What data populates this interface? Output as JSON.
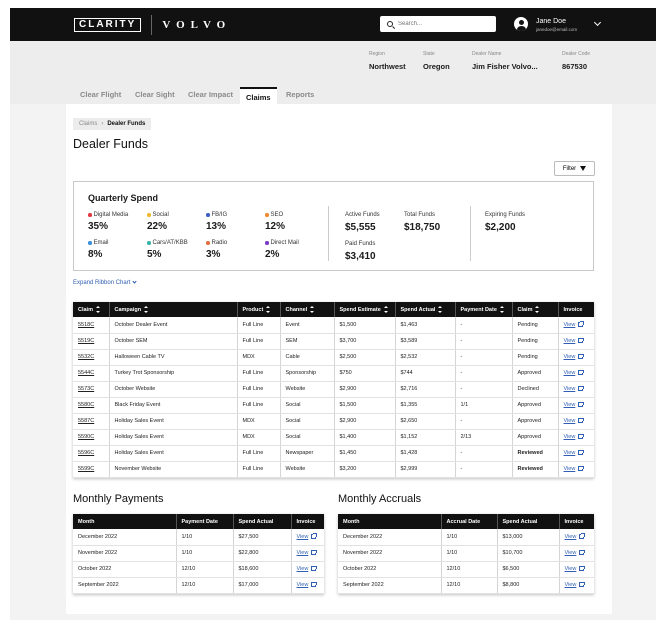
{
  "header": {
    "brand": "CLARITY",
    "partner": "VOLVO",
    "search_placeholder": "Search...",
    "user_name": "Jane Doe",
    "user_email": "janedoe@email.com"
  },
  "dealer": {
    "region_label": "Region",
    "region": "Northwest",
    "state_label": "State",
    "state": "Oregon",
    "name_label": "Dealer Name",
    "name": "Jim Fisher Volvo...",
    "code_label": "Dealer Code",
    "code": "867530"
  },
  "tabs": [
    "Clear Flight",
    "Clear Sight",
    "Clear Impact",
    "Claims",
    "Reports"
  ],
  "breadcrumb": {
    "parent": "Claims",
    "current": "Dealer Funds"
  },
  "page_title": "Dealer Funds",
  "filter_label": "Filter",
  "quarterly": {
    "title": "Quarterly Spend",
    "categories": [
      {
        "label": "Digital Media",
        "value": "35%",
        "color": "#e0383e"
      },
      {
        "label": "Social",
        "value": "22%",
        "color": "#f0b72e"
      },
      {
        "label": "FB/IG",
        "value": "13%",
        "color": "#3a5fc8"
      },
      {
        "label": "SEO",
        "value": "12%",
        "color": "#f08a2e"
      },
      {
        "label": "Email",
        "value": "8%",
        "color": "#3a8fd8"
      },
      {
        "label": "Cars/AT/KBB",
        "value": "5%",
        "color": "#36b3a8"
      },
      {
        "label": "Radio",
        "value": "3%",
        "color": "#e0703e"
      },
      {
        "label": "Direct Mail",
        "value": "2%",
        "color": "#7a3ac8"
      }
    ],
    "active_funds_label": "Active Funds",
    "active_funds": "$5,555",
    "total_funds_label": "Total Funds",
    "total_funds": "$18,750",
    "paid_funds_label": "Paid Funds",
    "paid_funds": "$3,410",
    "expiring_funds_label": "Expiring Funds",
    "expiring_funds": "$2,200"
  },
  "expand_label": "Expand Ribbon Chart",
  "claims_table": {
    "headers": [
      "Claim",
      "Campaign",
      "Product",
      "Channel",
      "Spend Estimate",
      "Spend Actual",
      "Payment Date",
      "Claim",
      "Invoice"
    ],
    "view_label": "View",
    "rows": [
      {
        "claim": "5518C",
        "campaign": "October Dealer Event",
        "product": "Full Line",
        "channel": "Event",
        "estimate": "$1,500",
        "actual": "$1,463",
        "payment_date": "-",
        "status": "Pending",
        "status_class": "st-pending"
      },
      {
        "claim": "5519C",
        "campaign": "October SEM",
        "product": "Full Line",
        "channel": "SEM",
        "estimate": "$3,700",
        "actual": "$3,589",
        "payment_date": "-",
        "status": "Pending",
        "status_class": "st-pending"
      },
      {
        "claim": "5532C",
        "campaign": "Halloween Cable TV",
        "product": "MDX",
        "channel": "Cable",
        "estimate": "$2,500",
        "actual": "$2,532",
        "payment_date": "-",
        "status": "Pending",
        "status_class": "st-pending"
      },
      {
        "claim": "5544C",
        "campaign": "Turkey Trot Sponsorship",
        "product": "Full Line",
        "channel": "Sponsorship",
        "estimate": "$750",
        "actual": "$744",
        "payment_date": "-",
        "status": "Approved",
        "status_class": "st-approved"
      },
      {
        "claim": "5573C",
        "campaign": "October Website",
        "product": "Full Line",
        "channel": "Website",
        "estimate": "$2,900",
        "actual": "$2,716",
        "payment_date": "-",
        "status": "Declined",
        "status_class": "st-declined"
      },
      {
        "claim": "5580C",
        "campaign": "Black Friday Event",
        "product": "Full Line",
        "channel": "Social",
        "estimate": "$1,500",
        "actual": "$1,355",
        "payment_date": "1/1",
        "status": "Approved",
        "status_class": "st-approved"
      },
      {
        "claim": "5587C",
        "campaign": "Holiday Sales Event",
        "product": "MDX",
        "channel": "Social",
        "estimate": "$2,900",
        "actual": "$2,650",
        "payment_date": "-",
        "status": "Approved",
        "status_class": "st-approved"
      },
      {
        "claim": "5590C",
        "campaign": "Holiday Sales Event",
        "product": "MDX",
        "channel": "Social",
        "estimate": "$1,400",
        "actual": "$1,152",
        "payment_date": "2/13",
        "status": "Approved",
        "status_class": "st-approved"
      },
      {
        "claim": "5596C",
        "campaign": "Holiday Sales Event",
        "product": "Full Line",
        "channel": "Newspaper",
        "estimate": "$1,450",
        "actual": "$1,428",
        "payment_date": "-",
        "status": "Reviewed",
        "status_class": "st-reviewed"
      },
      {
        "claim": "5599C",
        "campaign": "November Website",
        "product": "Full Line",
        "channel": "Website",
        "estimate": "$3,200",
        "actual": "$2,999",
        "payment_date": "-",
        "status": "Reviewed",
        "status_class": "st-reviewed"
      }
    ]
  },
  "monthly_payments": {
    "title": "Monthly Payments",
    "headers": [
      "Month",
      "Payment Date",
      "Spend Actual",
      "Invoice"
    ],
    "rows": [
      {
        "month": "December 2022",
        "date": "1/10",
        "amount": "$27,500"
      },
      {
        "month": "November 2022",
        "date": "1/10",
        "amount": "$22,800"
      },
      {
        "month": "October 2022",
        "date": "12/10",
        "amount": "$18,600"
      },
      {
        "month": "September 2022",
        "date": "12/10",
        "amount": "$17,000"
      }
    ]
  },
  "monthly_accruals": {
    "title": "Monthly Accruals",
    "headers": [
      "Month",
      "Accrual Date",
      "Spend Actual",
      "Invoice"
    ],
    "rows": [
      {
        "month": "December 2022",
        "date": "1/10",
        "amount": "$13,000"
      },
      {
        "month": "November 2022",
        "date": "1/10",
        "amount": "$10,700"
      },
      {
        "month": "October 2022",
        "date": "12/10",
        "amount": "$6,500"
      },
      {
        "month": "September 2022",
        "date": "12/10",
        "amount": "$8,800"
      }
    ]
  }
}
